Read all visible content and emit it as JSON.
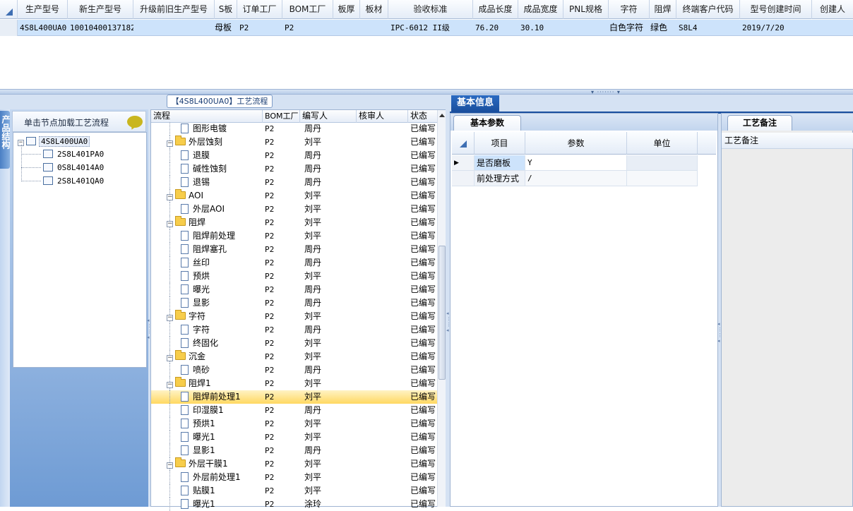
{
  "top_grid": {
    "columns": [
      "生产型号",
      "新生产型号",
      "升级前旧生产型号",
      "S板",
      "订单工厂",
      "BOM工厂",
      "板厚",
      "板材",
      "验收标准",
      "成品长度",
      "成品宽度",
      "PNL规格",
      "字符",
      "阻焊",
      "终端客户代码",
      "型号创建时间",
      "创建人"
    ],
    "row": [
      "4S8L400UA0",
      "10010400137182",
      "",
      "母板",
      "P2",
      "P2",
      "",
      "",
      "IPC-6012 II级",
      "76.20",
      "30.10",
      "",
      "白色字符",
      "绿色",
      "S8L4",
      "2019/7/20",
      ""
    ]
  },
  "left_panel": {
    "header": "单击节点加载工艺流程",
    "vertical_tab": "产品结构",
    "tree": [
      {
        "label": "4S8L400UA0",
        "level": 0,
        "expanded": true,
        "selected": true
      },
      {
        "label": "2S8L401PA0",
        "level": 1
      },
      {
        "label": "0S8L4014A0",
        "level": 1
      },
      {
        "label": "2S8L401QA0",
        "level": 1
      }
    ]
  },
  "middle_panel": {
    "title": "【4S8L400UA0】工艺流程",
    "columns": [
      "流程",
      "BOM工厂",
      "编写人",
      "核审人",
      "状态"
    ],
    "rows": [
      {
        "name": "图形电镀",
        "type": "doc",
        "level": 2,
        "bom": "P2",
        "author": "周丹",
        "reviewer": "",
        "status": "已编写"
      },
      {
        "name": "外层蚀刻",
        "type": "folder",
        "level": 1,
        "bom": "P2",
        "author": "刘平",
        "reviewer": "",
        "status": "已编写"
      },
      {
        "name": "退膜",
        "type": "doc",
        "level": 2,
        "bom": "P2",
        "author": "周丹",
        "reviewer": "",
        "status": "已编写"
      },
      {
        "name": "碱性蚀刻",
        "type": "doc",
        "level": 2,
        "bom": "P2",
        "author": "周丹",
        "reviewer": "",
        "status": "已编写"
      },
      {
        "name": "退锡",
        "type": "doc",
        "level": 2,
        "bom": "P2",
        "author": "周丹",
        "reviewer": "",
        "status": "已编写"
      },
      {
        "name": "AOI",
        "type": "folder",
        "level": 1,
        "bom": "P2",
        "author": "刘平",
        "reviewer": "",
        "status": "已编写"
      },
      {
        "name": "外层AOI",
        "type": "doc",
        "level": 2,
        "bom": "P2",
        "author": "刘平",
        "reviewer": "",
        "status": "已编写"
      },
      {
        "name": "阻焊",
        "type": "folder",
        "level": 1,
        "bom": "P2",
        "author": "刘平",
        "reviewer": "",
        "status": "已编写"
      },
      {
        "name": "阻焊前处理",
        "type": "doc",
        "level": 2,
        "bom": "P2",
        "author": "刘平",
        "reviewer": "",
        "status": "已编写"
      },
      {
        "name": "阻焊塞孔",
        "type": "doc",
        "level": 2,
        "bom": "P2",
        "author": "周丹",
        "reviewer": "",
        "status": "已编写"
      },
      {
        "name": "丝印",
        "type": "doc",
        "level": 2,
        "bom": "P2",
        "author": "周丹",
        "reviewer": "",
        "status": "已编写"
      },
      {
        "name": "预烘",
        "type": "doc",
        "level": 2,
        "bom": "P2",
        "author": "刘平",
        "reviewer": "",
        "status": "已编写"
      },
      {
        "name": "曝光",
        "type": "doc",
        "level": 2,
        "bom": "P2",
        "author": "周丹",
        "reviewer": "",
        "status": "已编写"
      },
      {
        "name": "显影",
        "type": "doc",
        "level": 2,
        "bom": "P2",
        "author": "周丹",
        "reviewer": "",
        "status": "已编写"
      },
      {
        "name": "字符",
        "type": "folder",
        "level": 1,
        "bom": "P2",
        "author": "刘平",
        "reviewer": "",
        "status": "已编写"
      },
      {
        "name": "字符",
        "type": "doc",
        "level": 2,
        "bom": "P2",
        "author": "周丹",
        "reviewer": "",
        "status": "已编写"
      },
      {
        "name": "终固化",
        "type": "doc",
        "level": 2,
        "bom": "P2",
        "author": "刘平",
        "reviewer": "",
        "status": "已编写"
      },
      {
        "name": "沉金",
        "type": "folder",
        "level": 1,
        "bom": "P2",
        "author": "刘平",
        "reviewer": "",
        "status": "已编写"
      },
      {
        "name": "喷砂",
        "type": "doc",
        "level": 2,
        "bom": "P2",
        "author": "周丹",
        "reviewer": "",
        "status": "已编写"
      },
      {
        "name": "阻焊1",
        "type": "folder",
        "level": 1,
        "bom": "P2",
        "author": "刘平",
        "reviewer": "",
        "status": "已编写"
      },
      {
        "name": "阻焊前处理1",
        "type": "doc",
        "level": 2,
        "bom": "P2",
        "author": "刘平",
        "reviewer": "",
        "status": "已编写",
        "highlight": true
      },
      {
        "name": "印湿膜1",
        "type": "doc",
        "level": 2,
        "bom": "P2",
        "author": "周丹",
        "reviewer": "",
        "status": "已编写"
      },
      {
        "name": "预烘1",
        "type": "doc",
        "level": 2,
        "bom": "P2",
        "author": "刘平",
        "reviewer": "",
        "status": "已编写"
      },
      {
        "name": "曝光1",
        "type": "doc",
        "level": 2,
        "bom": "P2",
        "author": "刘平",
        "reviewer": "",
        "status": "已编写"
      },
      {
        "name": "显影1",
        "type": "doc",
        "level": 2,
        "bom": "P2",
        "author": "周丹",
        "reviewer": "",
        "status": "已编写"
      },
      {
        "name": "外层干膜1",
        "type": "folder",
        "level": 1,
        "bom": "P2",
        "author": "刘平",
        "reviewer": "",
        "status": "已编写"
      },
      {
        "name": "外层前处理1",
        "type": "doc",
        "level": 2,
        "bom": "P2",
        "author": "刘平",
        "reviewer": "",
        "status": "已编写"
      },
      {
        "name": "贴膜1",
        "type": "doc",
        "level": 2,
        "bom": "P2",
        "author": "刘平",
        "reviewer": "",
        "status": "已编写"
      },
      {
        "name": "曝光1",
        "type": "doc",
        "level": 2,
        "bom": "P2",
        "author": "涂玲",
        "reviewer": "",
        "status": "已编写"
      }
    ]
  },
  "right_panel": {
    "top_tab": "基本信息",
    "params_tab": "基本参数",
    "params_columns": [
      "项目",
      "参数",
      "单位"
    ],
    "params_rows": [
      {
        "item": "是否磨板",
        "value": "Y",
        "unit": ""
      },
      {
        "item": "前处理方式",
        "value": "/",
        "unit": ""
      }
    ],
    "notes_tab": "工艺备注",
    "notes_label": "工艺备注"
  }
}
